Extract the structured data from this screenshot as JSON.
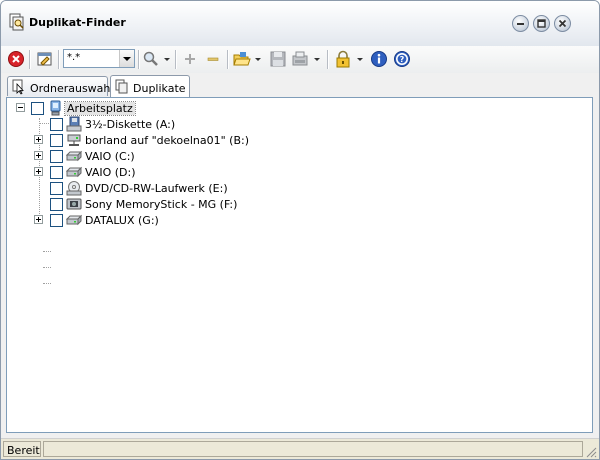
{
  "window": {
    "title": "Duplikat-Finder",
    "controls": [
      "minimize-icon",
      "maximize-icon",
      "close-icon"
    ]
  },
  "toolbar": {
    "filter_value": "*.*",
    "buttons": [
      "stop-icon",
      "edit-icon",
      "search-icon",
      "add-icon",
      "remove-icon",
      "folder-open-icon",
      "save-icon",
      "export-icon",
      "lock-icon",
      "info-icon",
      "help-icon"
    ]
  },
  "tabs": [
    {
      "label": "Ordnerauswahl",
      "active": false,
      "icon": "folder-select-icon"
    },
    {
      "label": "Duplikate",
      "active": true,
      "icon": "duplicates-icon"
    }
  ],
  "tree": {
    "root": {
      "label": "Arbeitsplatz",
      "icon": "computer-icon",
      "expanded": true
    },
    "items": [
      {
        "label": "3½-Diskette (A:)",
        "icon": "floppy-icon",
        "expandable": false
      },
      {
        "label": "borland auf \"dekoelna01\" (B:)",
        "icon": "network-drive-icon",
        "expandable": true
      },
      {
        "label": "VAIO (C:)",
        "icon": "hard-drive-icon",
        "expandable": true
      },
      {
        "label": "VAIO (D:)",
        "icon": "hard-drive-icon",
        "expandable": true
      },
      {
        "label": "DVD/CD-RW-Laufwerk (E:)",
        "icon": "cd-drive-icon",
        "expandable": false
      },
      {
        "label": "Sony MemoryStick - MG (F:)",
        "icon": "memory-stick-icon",
        "expandable": false
      },
      {
        "label": "DATALUX (G:)",
        "icon": "hard-drive-icon",
        "expandable": true
      }
    ]
  },
  "statusbar": {
    "text": "Bereit"
  }
}
